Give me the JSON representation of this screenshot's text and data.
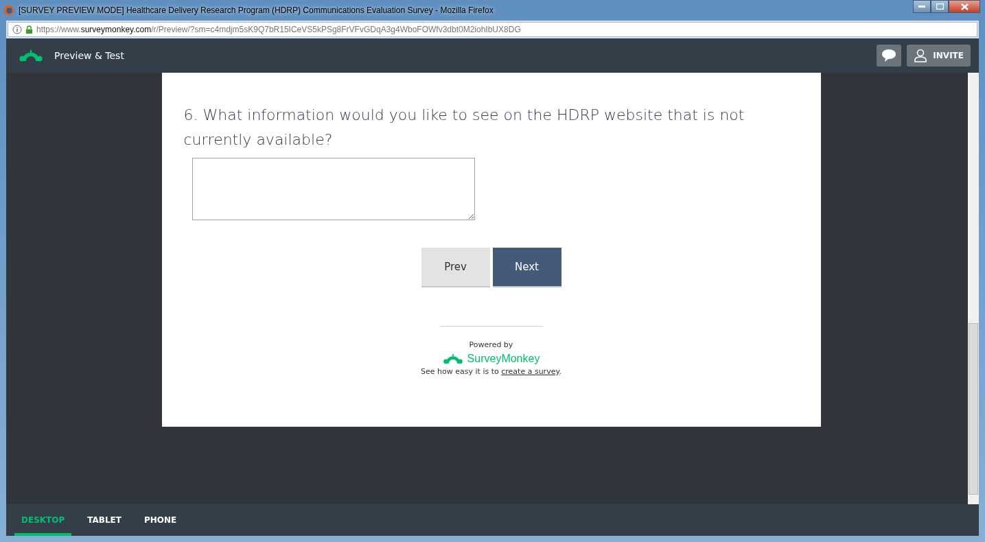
{
  "window": {
    "title": "[SURVEY PREVIEW MODE] Healthcare Delivery Research Program (HDRP) Communications Evaluation Survey - Mozilla Firefox"
  },
  "address_bar": {
    "url_prefix": "https://www.",
    "url_domain": "surveymonkey.com",
    "url_path": "/r/Preview/?sm=c4mdjm5sK9Q7bR15ICeVS5kPSg8FrVFvGDqA3g4WboFOWfv3dbt0M2iohIbUX8DG"
  },
  "header": {
    "title": "Preview & Test",
    "invite_label": "INVITE"
  },
  "question": {
    "text": "6. What information would you like to see on the HDRP website that is not currently available?"
  },
  "buttons": [
    {
      "label": "Prev",
      "kind": "secondary"
    },
    {
      "label": "Next",
      "kind": "primary"
    }
  ],
  "footer": {
    "powered_by": "Powered by",
    "brand": "SurveyMonkey",
    "tagline": "See how easy it is to",
    "link": "create a survey",
    "end": "."
  },
  "device_tabs": [
    {
      "label": "DESKTOP",
      "selected": true
    },
    {
      "label": "TABLET",
      "selected": false
    },
    {
      "label": "PHONE",
      "selected": false
    }
  ]
}
